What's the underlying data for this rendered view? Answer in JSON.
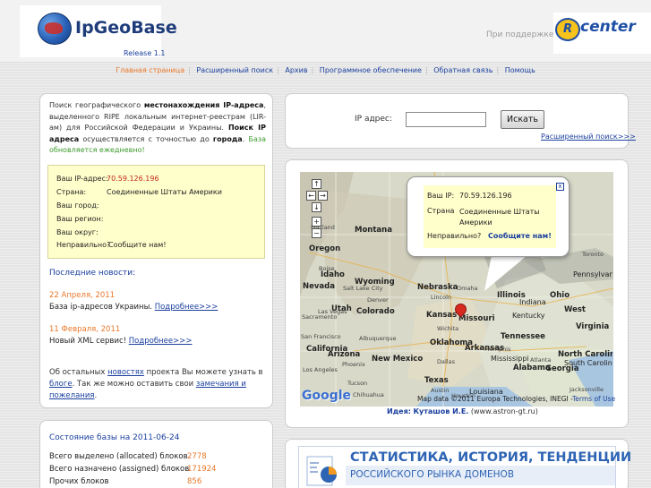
{
  "header": {
    "logo_text": "IpGeoBase",
    "release": "Release 1.1",
    "support_text": "При поддержке",
    "partner_logo_letter": "R",
    "partner_logo_text": "center"
  },
  "nav": [
    {
      "label": "Главная страница",
      "active": true
    },
    {
      "label": "Расширенный поиск"
    },
    {
      "label": "Архив"
    },
    {
      "label": "Программное обеспечение"
    },
    {
      "label": "Обратная связь"
    },
    {
      "label": "Помощь"
    }
  ],
  "intro": {
    "p1": "Поиск географического ",
    "b1": "местонахождения IP-адреса",
    "p2": ", выделенного RIPE локальным интернет-реестрам (LIR-ам) для Российской Федерации и Украины. ",
    "b2": "Поиск IP адреса",
    "p3": " осуществляется с точностью до ",
    "b3": "города",
    "p4": ". ",
    "green": "База обновляется ежедневно!"
  },
  "ipinfo": {
    "ip_label": "Ваш IP-адрес:",
    "ip_value": "70.59.126.196",
    "country_label": "Страна:",
    "country_value": "Соединенные Штаты Америки",
    "city_label": "Ваш город:",
    "region_label": "Ваш регион:",
    "district_label": "Ваш округ:",
    "wrong": "Неправильно?",
    "report": "Сообщите нам!"
  },
  "news": {
    "heading": "Последние новости:",
    "items": [
      {
        "date": "22 Апреля, 2011",
        "text": "База ip-адресов Украины. ",
        "link": "Подробнее>>>"
      },
      {
        "date": "11 Февраля, 2011",
        "text": "Новый XML сервис! ",
        "link": "Подробнее>>>"
      }
    ],
    "other_p1": "Об остальных ",
    "other_link1": "новостях",
    "other_p2": " проекта Вы можете узнать в ",
    "other_link2": "блоге",
    "other_p3": ". Так же можно оставить свои ",
    "other_link3": "замечания и пожелания",
    "other_p4": "."
  },
  "db_state": {
    "heading": "Состояние базы на 2011-06-24",
    "rows": [
      {
        "label": "Всего выделено (allocated) блоков",
        "value": "2778"
      },
      {
        "label": "Всего назначено (assigned) блоков",
        "value": "171924"
      },
      {
        "label": "Прочих блоков",
        "value": "856"
      }
    ]
  },
  "search": {
    "label": "IP адрес:",
    "button": "Искать",
    "input_value": "",
    "advanced_link": "Расширенный поиск>>>"
  },
  "map": {
    "labels": [
      {
        "t": "Montana",
        "s": "big"
      },
      {
        "t": "Oregon",
        "s": "big"
      },
      {
        "t": "Idaho",
        "s": "big"
      },
      {
        "t": "Wyoming",
        "s": "big"
      },
      {
        "t": "Nevada",
        "s": "big"
      },
      {
        "t": "Utah",
        "s": "big"
      },
      {
        "t": "Colorado",
        "s": "big"
      },
      {
        "t": "California",
        "s": "big"
      },
      {
        "t": "Arizona",
        "s": "big"
      },
      {
        "t": "New Mexico",
        "s": "big"
      },
      {
        "t": "Nebraska",
        "s": "big"
      },
      {
        "t": "Kansas",
        "s": "big"
      },
      {
        "t": "Missouri",
        "s": "big"
      },
      {
        "t": "Oklahoma",
        "s": "big"
      },
      {
        "t": "Arkansas",
        "s": "big"
      },
      {
        "t": "Texas",
        "s": "big"
      },
      {
        "t": "Illinois",
        "s": "big"
      },
      {
        "t": "Ohio",
        "s": "big"
      },
      {
        "t": "Indiana",
        "s": ""
      },
      {
        "t": "Kentucky",
        "s": ""
      },
      {
        "t": "Tennessee",
        "s": "big"
      },
      {
        "t": "Mississippi",
        "s": ""
      },
      {
        "t": "Alabama",
        "s": "big"
      },
      {
        "t": "Georgia",
        "s": "big"
      },
      {
        "t": "Louisiana",
        "s": ""
      },
      {
        "t": "Virginia",
        "s": "big"
      },
      {
        "t": "North Carolina",
        "s": "big"
      },
      {
        "t": "South Carolina",
        "s": ""
      },
      {
        "t": "Pennsylvania",
        "s": ""
      },
      {
        "t": "West",
        "s": "big"
      },
      {
        "t": "Portland",
        "s": "sm"
      },
      {
        "t": "Boise",
        "s": "sm"
      },
      {
        "t": "Salt Lake City",
        "s": "sm"
      },
      {
        "t": "Denver",
        "s": "sm"
      },
      {
        "t": "Lincoln",
        "s": "sm"
      },
      {
        "t": "Omaha",
        "s": "sm"
      },
      {
        "t": "Wichita",
        "s": "sm"
      },
      {
        "t": "Albuquerque",
        "s": "sm"
      },
      {
        "t": "Phoenix",
        "s": "sm"
      },
      {
        "t": "Tucson",
        "s": "sm"
      },
      {
        "t": "Dallas",
        "s": "sm"
      },
      {
        "t": "Austin",
        "s": "sm"
      },
      {
        "t": "Houston",
        "s": "sm"
      },
      {
        "t": "Memphis",
        "s": "sm"
      },
      {
        "t": "Atlanta",
        "s": "sm"
      },
      {
        "t": "Jacksonville",
        "s": "sm"
      },
      {
        "t": "Chihuahua",
        "s": "sm"
      },
      {
        "t": "Toronto",
        "s": "sm"
      },
      {
        "t": "Las Vegas",
        "s": "sm"
      },
      {
        "t": "Los Angeles",
        "s": "sm"
      },
      {
        "t": "Sacramento",
        "s": "sm"
      },
      {
        "t": "San Francisco",
        "s": "sm"
      }
    ],
    "popup": {
      "ip_label": "Ваш IP:",
      "ip_value": "70.59.126.196",
      "country_label": "Страна",
      "country_value": "Соединенные Штаты Америки",
      "wrong": "Неправильно?",
      "report": "Сообщите нам!",
      "close": "x"
    },
    "controls": [
      "↑",
      "←",
      "→",
      "↓",
      "+",
      "−"
    ],
    "copyright": "Map data ©2011 Europa Technologies, INEGI -",
    "terms": "Terms of Use",
    "google": "Google"
  },
  "idea": {
    "label": "Идея:",
    "name": "Куташов И.Е.",
    "site": " (www.astron-gt.ru)"
  },
  "banner": {
    "title": "СТАТИСТИКА, ИСТОРИЯ, ТЕНДЕНЦИИ",
    "subtitle": "РОССИЙСКОГО РЫНКА ДОМЕНОВ"
  }
}
